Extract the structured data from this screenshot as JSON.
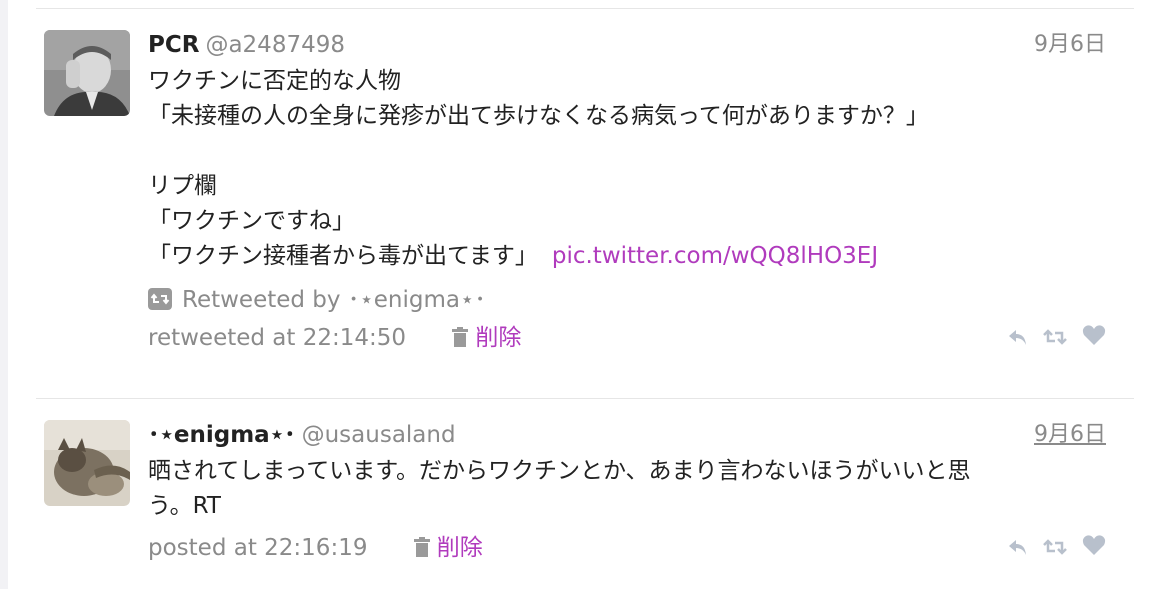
{
  "tweets": [
    {
      "name": "PCR",
      "handle": "@a2487498",
      "date": "9月6日",
      "text_lines": [
        "ワクチンに否定的な人物",
        "「未接種の人の全身に発疹が出て歩けなくなる病気って何がありますか？」",
        "",
        "リプ欄",
        "「ワクチンですね」",
        "「ワクチン接種者から毒が出てます」"
      ],
      "pic_link": "pic.twitter.com/wQQ8lHO3EJ",
      "retweeted_by": "Retweeted by ･⋆enigma⋆･",
      "meta": "retweeted at 22:14:50",
      "delete_label": "削除",
      "icons": [
        "retweet-badge-icon",
        "trash-icon",
        "reply-icon",
        "retweet-icon",
        "heart-icon"
      ]
    },
    {
      "name": "･⋆enigma⋆･",
      "handle": "@usausaland",
      "date": "9月6日",
      "text_lines": [
        "晒されてしまっています。だからワクチンとか、あまり言わないほうがいいと思",
        "う。RT"
      ],
      "meta": "posted at 22:16:19",
      "delete_label": "削除",
      "icons": [
        "trash-icon",
        "reply-icon",
        "retweet-icon",
        "heart-icon"
      ]
    }
  ],
  "colors": {
    "link": "#b03bbd",
    "muted": "#8a8a8a",
    "text": "#222222",
    "separator": "#e6e6e6",
    "action_icons": "#b8c0cc"
  }
}
